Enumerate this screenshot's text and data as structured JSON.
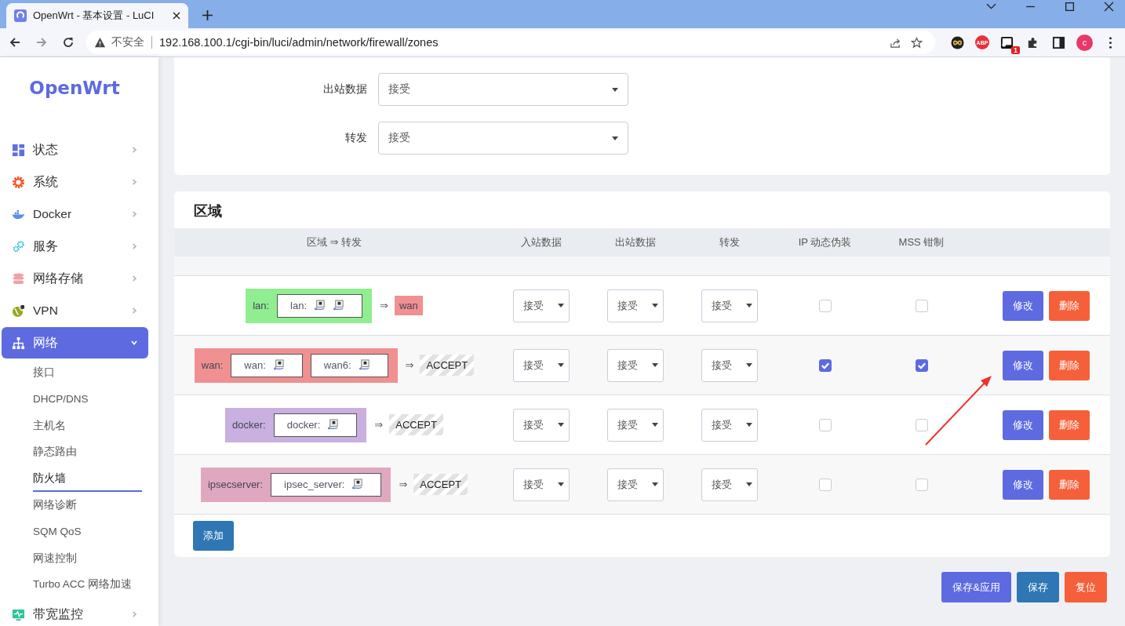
{
  "browser": {
    "tab_title": "OpenWrt - 基本设置 - LuCI",
    "security_label": "不安全",
    "url": "192.168.100.1/cgi-bin/luci/admin/network/firewall/zones",
    "adblock_label": "ABP",
    "extension_badge": "1",
    "profile_initial": "c"
  },
  "sidebar": {
    "logo": "OpenWrt",
    "items": [
      {
        "kind": "dashboard",
        "label": "状态",
        "expanded": false
      },
      {
        "kind": "gear",
        "label": "系统",
        "expanded": false
      },
      {
        "kind": "whale",
        "label": "Docker",
        "expanded": false
      },
      {
        "kind": "gears",
        "label": "服务",
        "expanded": false
      },
      {
        "kind": "database",
        "label": "网络存储",
        "expanded": false
      },
      {
        "kind": "globe",
        "label": "VPN",
        "expanded": false
      },
      {
        "kind": "network",
        "label": "网络",
        "expanded": true,
        "children": [
          {
            "label": "接口",
            "selected": false
          },
          {
            "label": "DHCP/DNS",
            "selected": false
          },
          {
            "label": "主机名",
            "selected": false
          },
          {
            "label": "静态路由",
            "selected": false
          },
          {
            "label": "防火墙",
            "selected": true
          },
          {
            "label": "网络诊断",
            "selected": false
          },
          {
            "label": "SQM QoS",
            "selected": false
          },
          {
            "label": "网速控制",
            "selected": false
          },
          {
            "label": "Turbo ACC 网络加速",
            "selected": false
          }
        ]
      },
      {
        "kind": "monitor",
        "label": "带宽监控",
        "expanded": false
      }
    ]
  },
  "defaults": {
    "fields": [
      {
        "label": "出站数据",
        "value": "接受"
      },
      {
        "label": "转发",
        "value": "接受"
      }
    ]
  },
  "zones": {
    "title": "区域",
    "columns": [
      "区域 ⇒ 转发",
      "入站数据",
      "出站数据",
      "转发",
      "IP 动态伪装",
      "MSS 钳制"
    ],
    "rows": [
      {
        "name": "lan:",
        "color": "#90ee90",
        "networks": [
          {
            "label": "lan:",
            "devices": [
              {
                "kind": "ethernet"
              },
              {
                "kind": "ethernet"
              }
            ]
          }
        ],
        "arrow": "⇒",
        "forward": {
          "kind": "zone",
          "text": "wan",
          "color": "#f09090"
        },
        "input": "接受",
        "output": "接受",
        "forward_policy": "接受",
        "masquerading": false,
        "mss_clamping": false,
        "edit_label": "修改",
        "delete_label": "删除"
      },
      {
        "name": "wan:",
        "color": "#f09090",
        "networks": [
          {
            "label": "wan:",
            "devices": [
              {
                "kind": "ethernet"
              }
            ]
          },
          {
            "label": "wan6:",
            "devices": [
              {
                "kind": "ethernet"
              }
            ]
          }
        ],
        "arrow": "⇒",
        "forward": {
          "kind": "policy",
          "text": "ACCEPT"
        },
        "input": "接受",
        "output": "接受",
        "forward_policy": "接受",
        "masquerading": true,
        "mss_clamping": true,
        "edit_label": "修改",
        "delete_label": "删除"
      },
      {
        "name": "docker:",
        "color": "#c9b0e0",
        "networks": [
          {
            "label": "docker:",
            "devices": [
              {
                "kind": "ethernet"
              }
            ]
          }
        ],
        "arrow": "⇒",
        "forward": {
          "kind": "policy",
          "text": "ACCEPT"
        },
        "input": "接受",
        "output": "接受",
        "forward_policy": "接受",
        "masquerading": false,
        "mss_clamping": false,
        "edit_label": "修改",
        "delete_label": "删除"
      },
      {
        "name": "ipsecserver:",
        "color": "#e0a8c0",
        "networks": [
          {
            "label": "ipsec_server:",
            "devices": [
              {
                "kind": "ethernet"
              }
            ]
          }
        ],
        "arrow": "⇒",
        "forward": {
          "kind": "policy",
          "text": "ACCEPT"
        },
        "input": "接受",
        "output": "接受",
        "forward_policy": "接受",
        "masquerading": false,
        "mss_clamping": false,
        "edit_label": "修改",
        "delete_label": "删除"
      }
    ],
    "add_label": "添加"
  },
  "footer": {
    "buttons": [
      {
        "kind": "save-apply",
        "label": "保存&应用"
      },
      {
        "kind": "save",
        "label": "保存"
      },
      {
        "kind": "reset",
        "label": "复位"
      }
    ]
  }
}
